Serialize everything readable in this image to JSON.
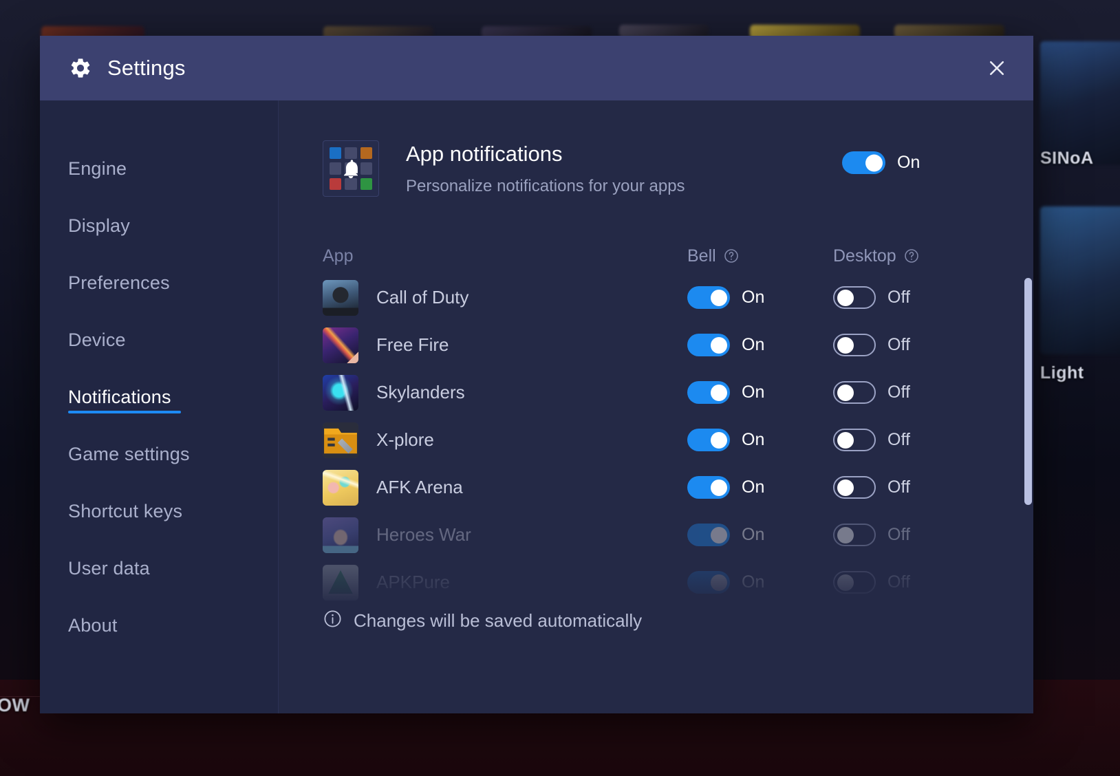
{
  "window": {
    "title": "Settings",
    "gear_icon": "gear-icon",
    "close_icon": "close-icon"
  },
  "sidebar": {
    "items": [
      {
        "label": "Engine",
        "active": false
      },
      {
        "label": "Display",
        "active": false
      },
      {
        "label": "Preferences",
        "active": false
      },
      {
        "label": "Device",
        "active": false
      },
      {
        "label": "Notifications",
        "active": true
      },
      {
        "label": "Game settings",
        "active": false
      },
      {
        "label": "Shortcut keys",
        "active": false
      },
      {
        "label": "User data",
        "active": false
      },
      {
        "label": "About",
        "active": false
      }
    ]
  },
  "section": {
    "icon": "app-notifications-grid-bell-icon",
    "title": "App notifications",
    "subtitle": "Personalize notifications for your apps",
    "master_toggle": {
      "state": "On",
      "enabled": true
    }
  },
  "table": {
    "headers": {
      "app": "App",
      "bell": "Bell",
      "desktop": "Desktop",
      "help_icon": "question-mark-icon"
    },
    "rows": [
      {
        "name": "Call of Duty",
        "bell": "On",
        "bell_on": true,
        "desktop": "Off",
        "desktop_on": false,
        "faded": false
      },
      {
        "name": "Free Fire",
        "bell": "On",
        "bell_on": true,
        "desktop": "Off",
        "desktop_on": false,
        "faded": false
      },
      {
        "name": "Skylanders",
        "bell": "On",
        "bell_on": true,
        "desktop": "Off",
        "desktop_on": false,
        "faded": false
      },
      {
        "name": "X-plore",
        "bell": "On",
        "bell_on": true,
        "desktop": "Off",
        "desktop_on": false,
        "faded": false
      },
      {
        "name": "AFK Arena",
        "bell": "On",
        "bell_on": true,
        "desktop": "Off",
        "desktop_on": false,
        "faded": false
      },
      {
        "name": "Heroes War",
        "bell": "On",
        "bell_on": true,
        "desktop": "Off",
        "desktop_on": false,
        "faded": true
      },
      {
        "name": "APKPure",
        "bell": "On",
        "bell_on": true,
        "desktop": "Off",
        "desktop_on": false,
        "faded": true
      }
    ]
  },
  "footer": {
    "icon": "info-icon",
    "text": "Changes will be saved automatically"
  },
  "background": {
    "labels": [
      "SINoA",
      "Light",
      "OW"
    ]
  },
  "colors": {
    "accent": "#1c8af0",
    "titlebar": "#3c4170",
    "panel": "#242946",
    "sidebar": "#212643",
    "text_primary": "#ffffff",
    "text_muted": "#9aa1bf"
  }
}
